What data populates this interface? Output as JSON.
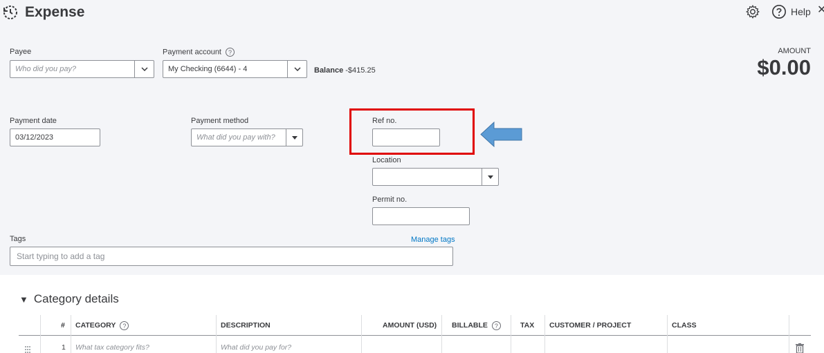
{
  "header": {
    "title": "Expense",
    "help_label": "Help",
    "close_glyph": "✕"
  },
  "payee": {
    "label": "Payee",
    "placeholder": "Who did you pay?"
  },
  "payment_account": {
    "label": "Payment account",
    "value": "My Checking (6644) - 4",
    "balance_label": "Balance",
    "balance_value": "-$415.25"
  },
  "amount": {
    "label": "AMOUNT",
    "value": "$0.00"
  },
  "payment_date": {
    "label": "Payment date",
    "value": "03/12/2023"
  },
  "payment_method": {
    "label": "Payment method",
    "placeholder": "What did you pay with?"
  },
  "ref_no": {
    "label": "Ref no.",
    "value": ""
  },
  "location": {
    "label": "Location",
    "value": ""
  },
  "permit_no": {
    "label": "Permit no.",
    "value": ""
  },
  "tags": {
    "label": "Tags",
    "manage_link": "Manage tags",
    "placeholder": "Start typing to add a tag"
  },
  "category_details": {
    "toggle_glyph": "▼",
    "title": "Category details",
    "columns": [
      "#",
      "CATEGORY",
      "DESCRIPTION",
      "AMOUNT (USD)",
      "BILLABLE",
      "TAX",
      "CUSTOMER / PROJECT",
      "CLASS"
    ],
    "rows": [
      {
        "num": "1",
        "category_placeholder": "What tax category fits?",
        "description_placeholder": "What did you pay for?"
      }
    ]
  },
  "annotation": {
    "highlight_color": "#e00000",
    "arrow_color": "#5b9bd5"
  }
}
